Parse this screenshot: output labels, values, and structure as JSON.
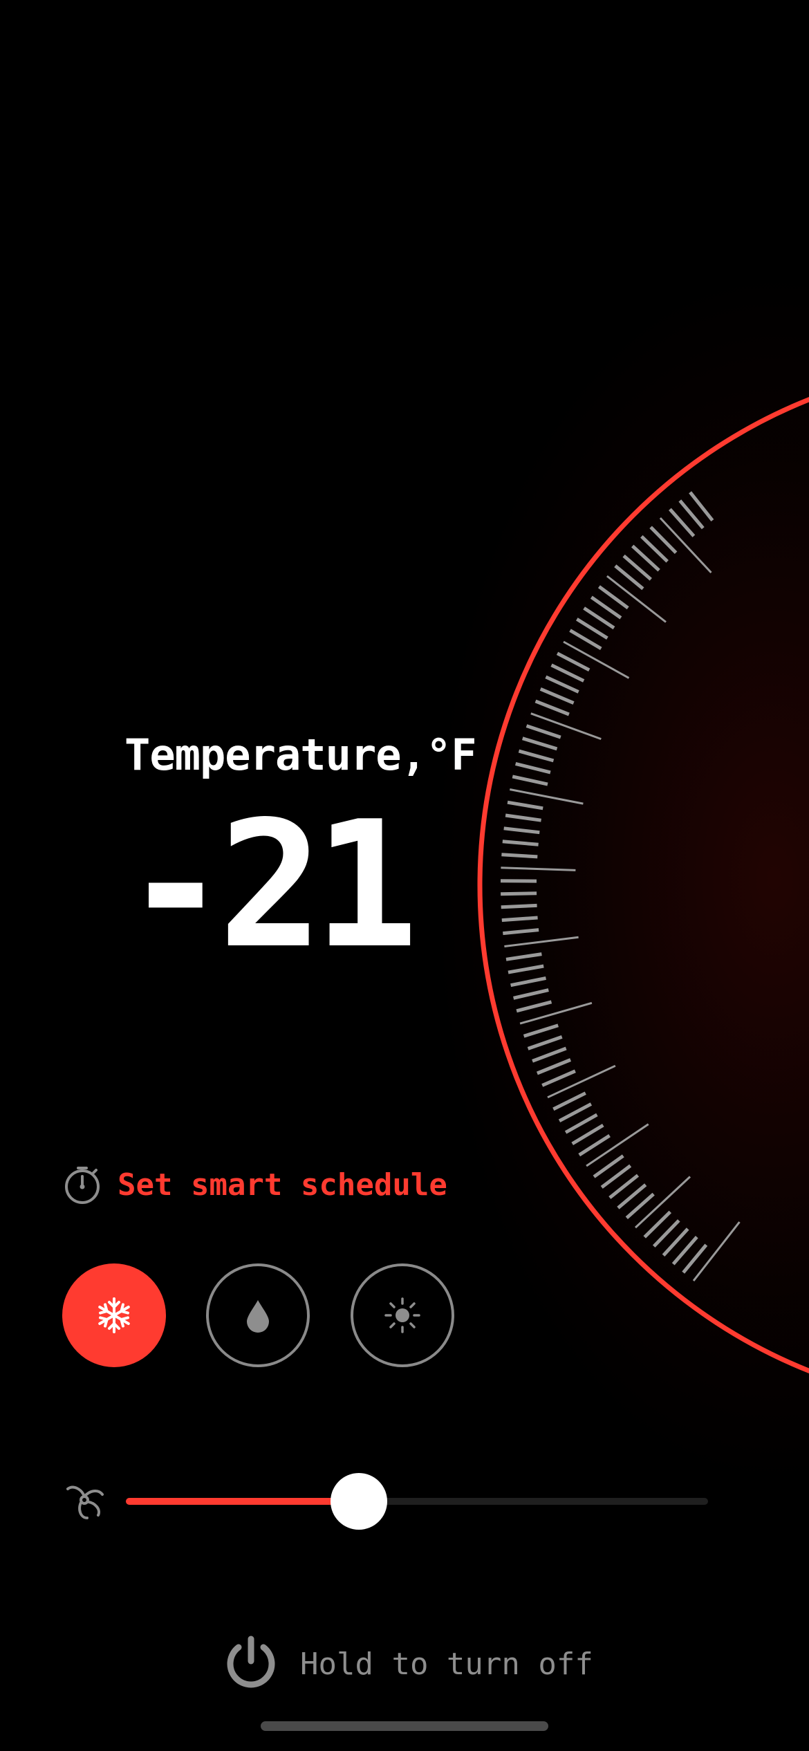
{
  "theme": {
    "accent": "#ff3b30",
    "background": "#000000",
    "tick_color": "#9a9a9a",
    "muted_text": "#8e8e8e"
  },
  "temperature": {
    "label": "Temperature,°F",
    "value": "-21"
  },
  "schedule": {
    "icon": "stopwatch-icon",
    "label": "Set smart schedule"
  },
  "modes": [
    {
      "name": "cool",
      "icon": "snowflake-icon",
      "active": true
    },
    {
      "name": "dry",
      "icon": "water-drop-icon",
      "active": false
    },
    {
      "name": "heat",
      "icon": "sun-icon",
      "active": false
    }
  ],
  "fan": {
    "icon": "fan-icon",
    "speed_fraction": 0.4
  },
  "power": {
    "icon": "power-icon",
    "label": "Hold to turn off"
  }
}
